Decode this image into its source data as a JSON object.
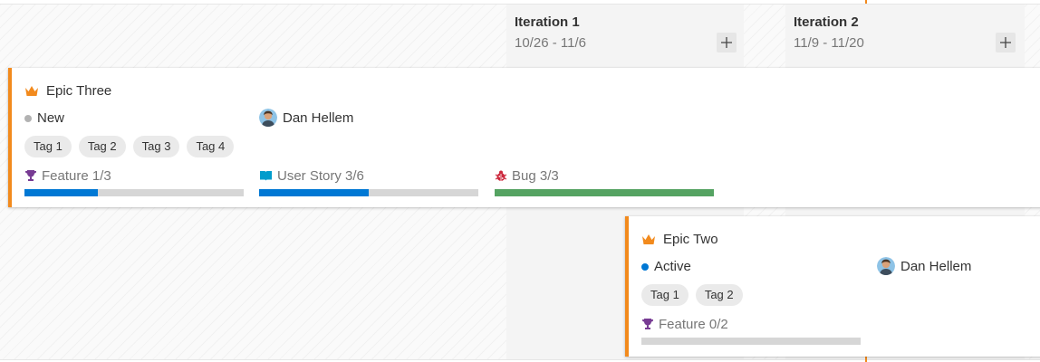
{
  "colors": {
    "accent_epic": "#f28a1d",
    "progress_blue": "#0078d4",
    "progress_green": "#55a362",
    "state_new": "#b2b2b2",
    "state_active": "#0078d4",
    "feature_icon": "#773b93",
    "story_icon": "#009ccc",
    "bug_icon": "#cc293d"
  },
  "iterations": [
    {
      "title": "Iteration 1",
      "dates": "10/26 - 11/6"
    },
    {
      "title": "Iteration 2",
      "dates": "11/9 - 11/20"
    }
  ],
  "add_icon": "plus-icon",
  "cards": [
    {
      "type_icon": "crown-icon",
      "title": "Epic Three",
      "state": "New",
      "assignee": "Dan Hellem",
      "tags": [
        "Tag 1",
        "Tag 2",
        "Tag 3",
        "Tag 4"
      ],
      "rollups": [
        {
          "icon": "trophy-icon",
          "label": "Feature 1/3",
          "progress": 0.333,
          "color": "#0078d4"
        },
        {
          "icon": "book-icon",
          "label": "User Story 3/6",
          "progress": 0.5,
          "color": "#0078d4"
        },
        {
          "icon": "bug-icon",
          "label": "Bug 3/3",
          "progress": 1.0,
          "color": "#55a362"
        }
      ]
    },
    {
      "type_icon": "crown-icon",
      "title": "Epic Two",
      "state": "Active",
      "assignee": "Dan Hellem",
      "tags": [
        "Tag 1",
        "Tag 2"
      ],
      "rollups": [
        {
          "icon": "trophy-icon",
          "label": "Feature 0/2",
          "progress": 0.0,
          "color": "#0078d4"
        }
      ]
    }
  ]
}
